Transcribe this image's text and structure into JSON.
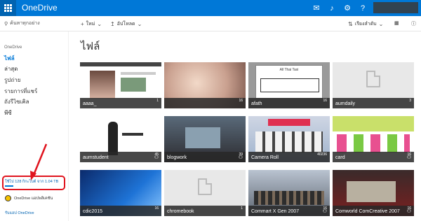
{
  "app": {
    "title": "OneDrive"
  },
  "topbar": {
    "icons": [
      "chat-icon",
      "bell-icon",
      "gear-icon",
      "help-icon"
    ],
    "glyphs": [
      "✉",
      "♪",
      "⚙",
      "?"
    ]
  },
  "search": {
    "placeholder": "ค้นหาทุกอย่าง"
  },
  "commands": {
    "new_label": "ใหม่",
    "upload_label": "อัปโหลด",
    "sort_label": "เรียงลำดับ"
  },
  "nav": {
    "section": "OneDrive",
    "items": [
      {
        "label": "ไฟล์",
        "active": true
      },
      {
        "label": "ล่าสุด"
      },
      {
        "label": "รูปถ่าย"
      },
      {
        "label": "รายการที่แชร์"
      },
      {
        "label": "ถังรีไซเคิล"
      },
      {
        "label": "พีซี"
      }
    ],
    "storage_text": "ใช้ไป 128 กิกะไบต์ จาก 1.04 TB",
    "app_label": "OneDrive แอปพลิเคชัน",
    "get_link": "รับแอป OneDrive"
  },
  "main": {
    "title": "ไฟล์"
  },
  "folders": [
    {
      "name": "aaaa_",
      "count": "1",
      "shared": false,
      "thumb": "blurry-photos"
    },
    {
      "name": "",
      "count": "16",
      "shared": false,
      "thumb": "blurry-pink"
    },
    {
      "name": "afath",
      "count": "16",
      "shared": false,
      "thumb": "taxi-dialog"
    },
    {
      "name": "aumdaily",
      "count": "3",
      "shared": false,
      "thumb": "doc"
    },
    {
      "name": "aumstudent",
      "count": "45",
      "shared": true,
      "thumb": "musician"
    },
    {
      "name": "blogwork",
      "count": "39",
      "shared": true,
      "thumb": "hall"
    },
    {
      "name": "Camera Roll",
      "count": "40236",
      "shared": false,
      "thumb": "expo"
    },
    {
      "name": "card",
      "count": "16",
      "shared": true,
      "thumb": "stickers"
    },
    {
      "name": "cdic2015",
      "count": "16",
      "shared": false,
      "thumb": "windows"
    },
    {
      "name": "chromebook",
      "count": "1",
      "shared": false,
      "thumb": "doc"
    },
    {
      "name": "Commart X Gen 2007",
      "count": "16",
      "shared": true,
      "thumb": "crowd"
    },
    {
      "name": "Comworld ComCreative 2007",
      "count": "16",
      "shared": true,
      "thumb": "store"
    }
  ],
  "colors": {
    "brand": "#0078d7",
    "highlight": "#e0141e"
  }
}
